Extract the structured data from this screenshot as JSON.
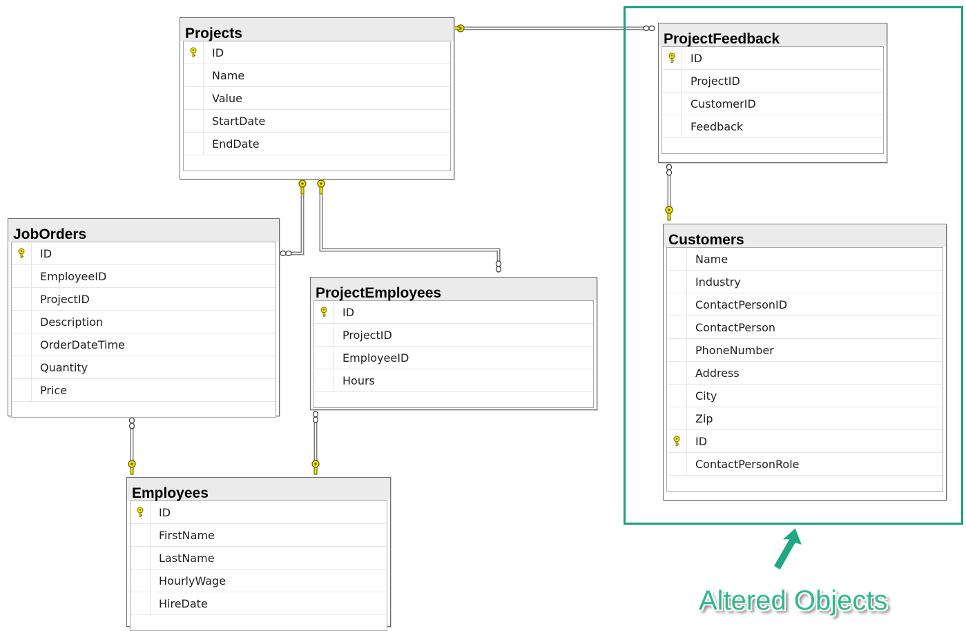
{
  "tables": {
    "projects": {
      "title": "Projects",
      "columns": [
        {
          "name": "ID",
          "pk": true
        },
        {
          "name": "Name"
        },
        {
          "name": "Value"
        },
        {
          "name": "StartDate"
        },
        {
          "name": "EndDate"
        }
      ]
    },
    "project_feedback": {
      "title": "ProjectFeedback",
      "columns": [
        {
          "name": "ID",
          "pk": true
        },
        {
          "name": "ProjectID"
        },
        {
          "name": "CustomerID"
        },
        {
          "name": "Feedback"
        }
      ]
    },
    "job_orders": {
      "title": "JobOrders",
      "columns": [
        {
          "name": "ID",
          "pk": true
        },
        {
          "name": "EmployeeID"
        },
        {
          "name": "ProjectID"
        },
        {
          "name": "Description"
        },
        {
          "name": "OrderDateTime"
        },
        {
          "name": "Quantity"
        },
        {
          "name": "Price"
        }
      ]
    },
    "project_employees": {
      "title": "ProjectEmployees",
      "columns": [
        {
          "name": "ID",
          "pk": true
        },
        {
          "name": "ProjectID"
        },
        {
          "name": "EmployeeID"
        },
        {
          "name": "Hours"
        }
      ]
    },
    "customers": {
      "title": "Customers",
      "columns": [
        {
          "name": "Name"
        },
        {
          "name": "Industry"
        },
        {
          "name": "ContactPersonID"
        },
        {
          "name": "ContactPerson"
        },
        {
          "name": "PhoneNumber"
        },
        {
          "name": "Address"
        },
        {
          "name": "City"
        },
        {
          "name": "Zip"
        },
        {
          "name": "ID",
          "pk": true
        },
        {
          "name": "ContactPersonRole"
        }
      ]
    },
    "employees": {
      "title": "Employees",
      "columns": [
        {
          "name": "ID",
          "pk": true
        },
        {
          "name": "FirstName"
        },
        {
          "name": "LastName"
        },
        {
          "name": "HourlyWage"
        },
        {
          "name": "HireDate"
        }
      ]
    }
  },
  "relationships": [
    {
      "from": "project_feedback",
      "to": "projects",
      "one_end": "projects"
    },
    {
      "from": "job_orders",
      "to": "projects",
      "one_end": "projects"
    },
    {
      "from": "project_employees",
      "to": "projects",
      "one_end": "projects"
    },
    {
      "from": "project_feedback",
      "to": "customers",
      "one_end": "customers"
    },
    {
      "from": "job_orders",
      "to": "employees",
      "one_end": "employees"
    },
    {
      "from": "project_employees",
      "to": "employees",
      "one_end": "employees"
    }
  ],
  "highlight": {
    "caption": "Altered Objects",
    "color": "#19a07e"
  },
  "colors": {
    "key_icon": "#f2e600",
    "line": "#808080",
    "border": "#6d6d6d",
    "header": "#ebebeb"
  }
}
